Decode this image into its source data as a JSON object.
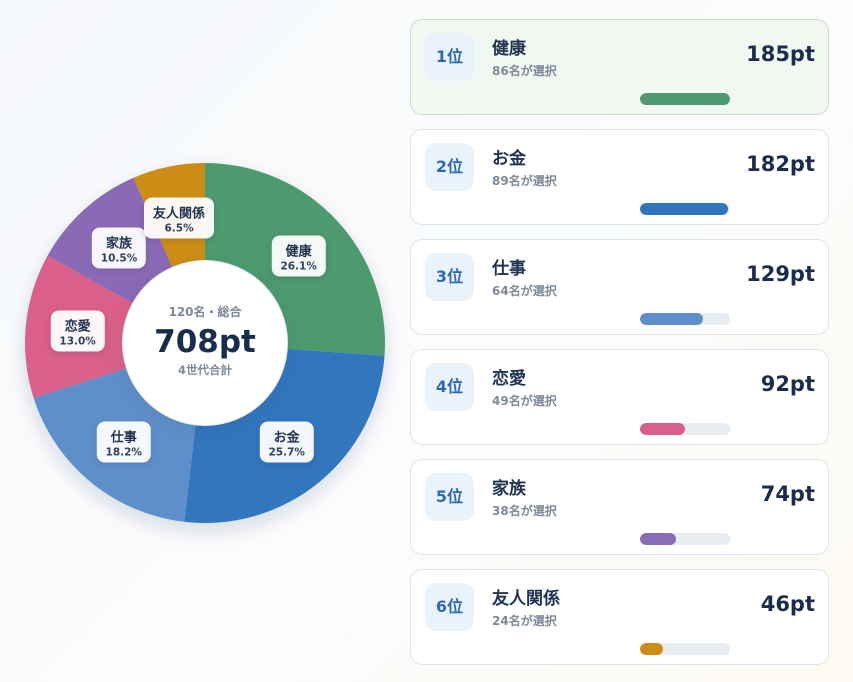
{
  "center": {
    "subtitle": "120名・総合",
    "total": "708pt",
    "note": "4世代合計"
  },
  "chart_data": {
    "type": "pie",
    "donut": true,
    "unit": "pt",
    "slices": [
      {
        "name": "健康",
        "value": 185,
        "percent_label": "26.1%",
        "color": "#4e9a6e"
      },
      {
        "name": "お金",
        "value": 182,
        "percent_label": "25.7%",
        "color": "#3176bd"
      },
      {
        "name": "仕事",
        "value": 129,
        "percent_label": "18.2%",
        "color": "#5f8fca"
      },
      {
        "name": "恋愛",
        "value": 92,
        "percent_label": "13.0%",
        "color": "#d9608a"
      },
      {
        "name": "家族",
        "value": 74,
        "percent_label": "10.5%",
        "color": "#8a6bb5"
      },
      {
        "name": "友人関係",
        "value": 46,
        "percent_label": "6.5%",
        "color": "#cc8c17"
      }
    ]
  },
  "ranking": [
    {
      "rank": "1位",
      "name": "健康",
      "voters": "86名が選択",
      "points": "185pt",
      "bar_fraction": 1.0,
      "color": "#4e9a6e"
    },
    {
      "rank": "2位",
      "name": "お金",
      "voters": "89名が選択",
      "points": "182pt",
      "bar_fraction": 0.98,
      "color": "#3176bd"
    },
    {
      "rank": "3位",
      "name": "仕事",
      "voters": "64名が選択",
      "points": "129pt",
      "bar_fraction": 0.7,
      "color": "#5f8fca"
    },
    {
      "rank": "4位",
      "name": "恋愛",
      "voters": "49名が選択",
      "points": "92pt",
      "bar_fraction": 0.5,
      "color": "#d9608a"
    },
    {
      "rank": "5位",
      "name": "家族",
      "voters": "38名が選択",
      "points": "74pt",
      "bar_fraction": 0.4,
      "color": "#8a6bb5"
    },
    {
      "rank": "6位",
      "name": "友人関係",
      "voters": "24名が選択",
      "points": "46pt",
      "bar_fraction": 0.25,
      "color": "#cc8c17"
    }
  ]
}
